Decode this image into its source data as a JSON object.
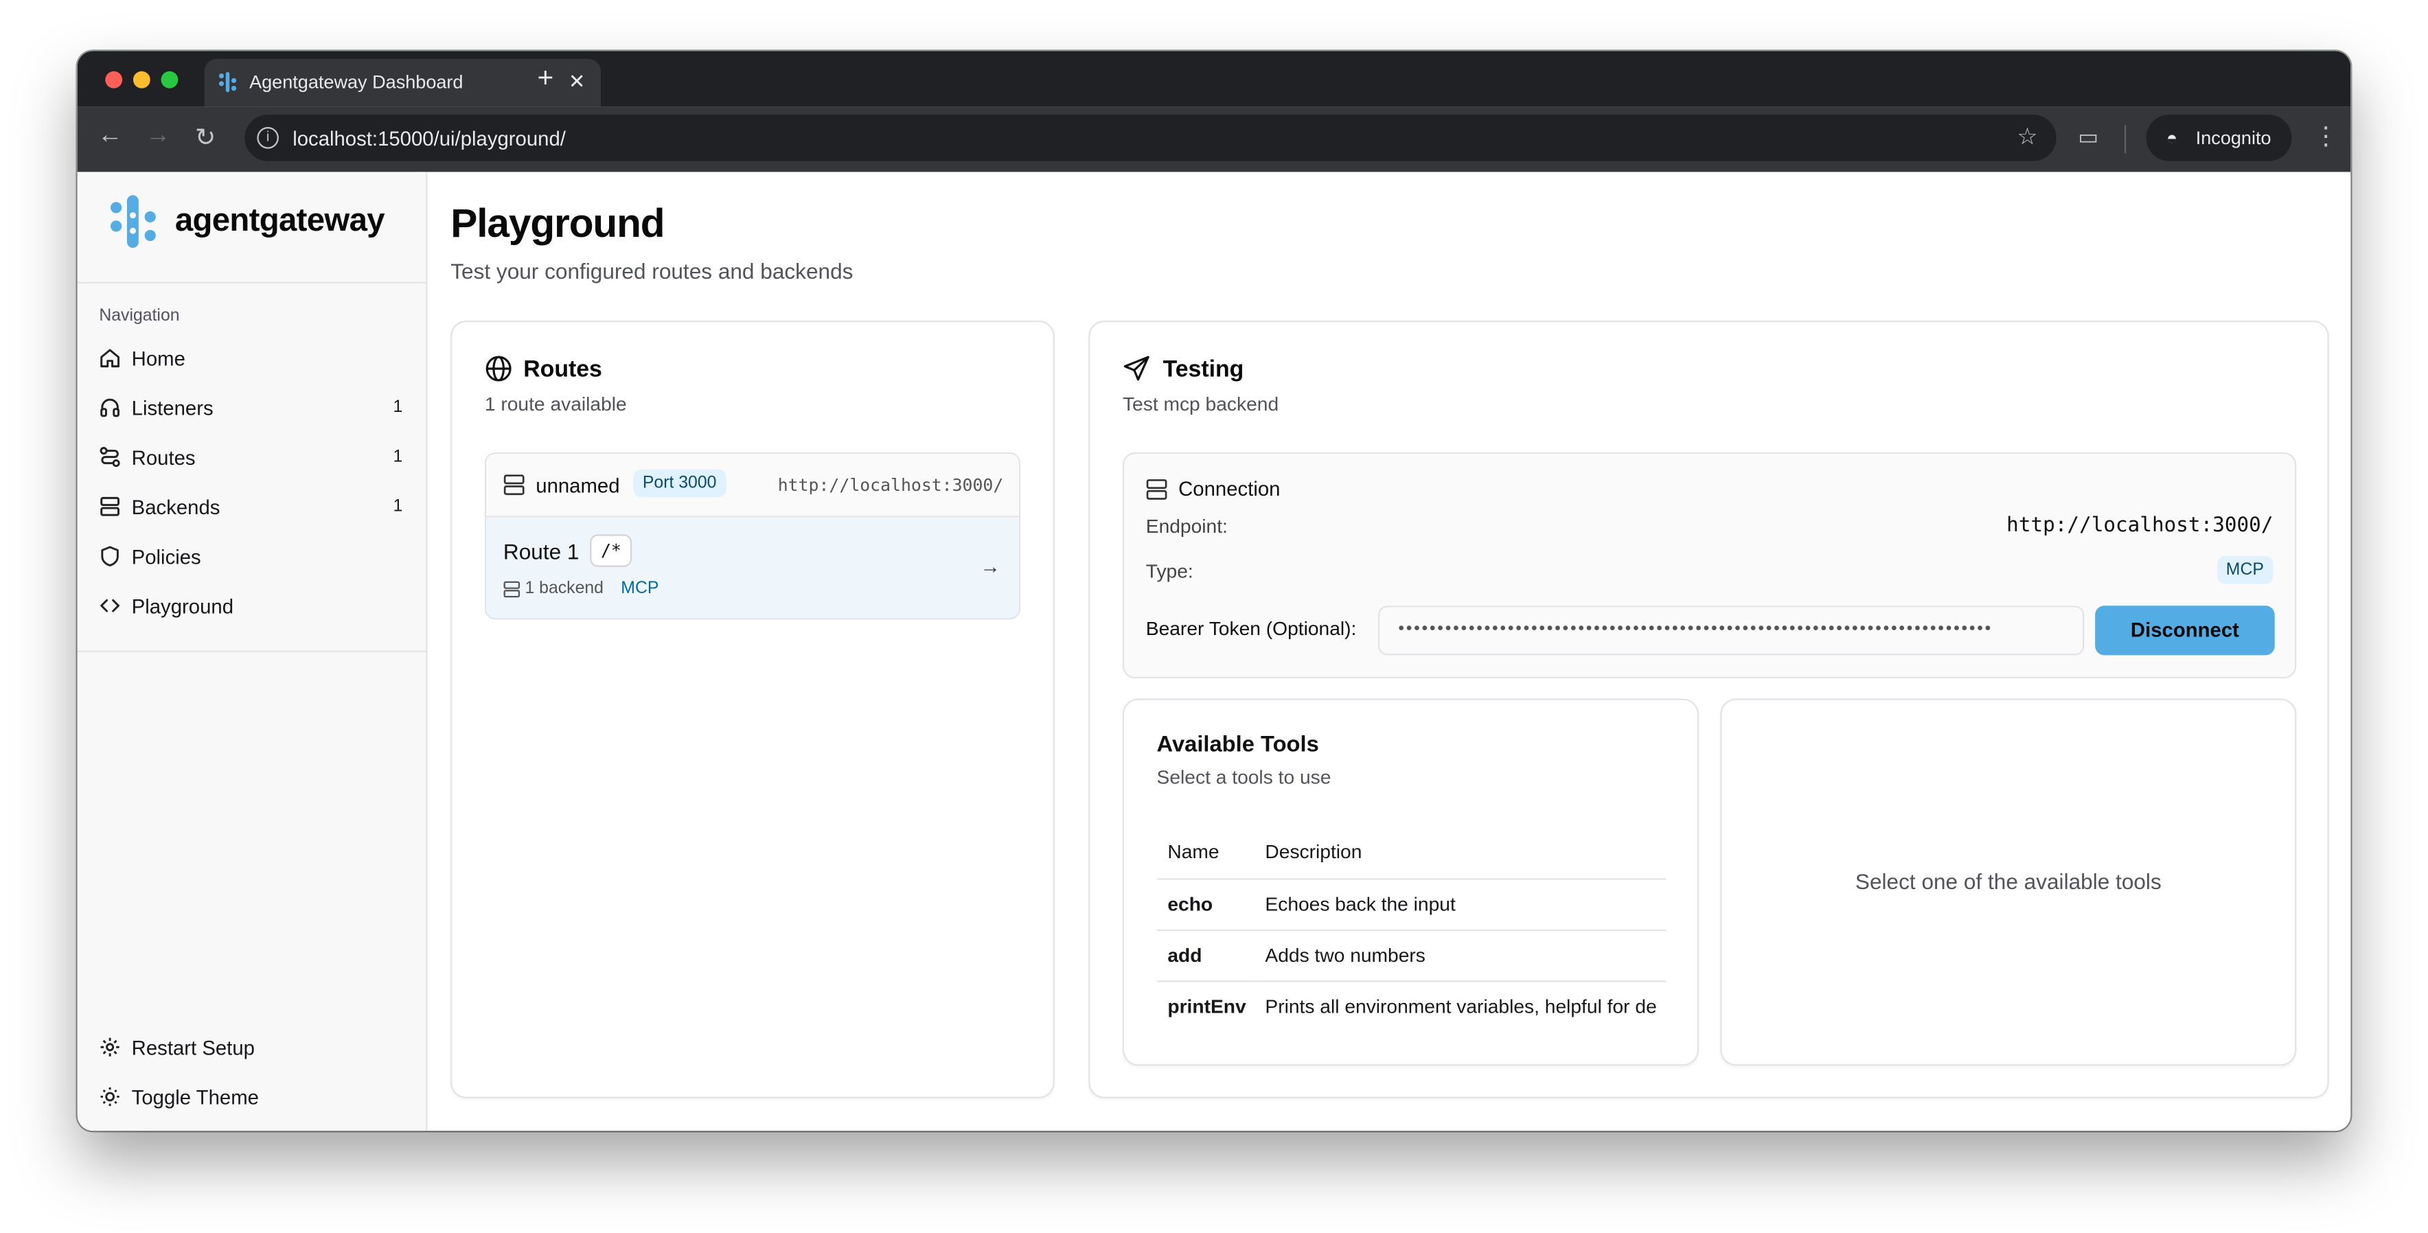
{
  "browser": {
    "tab_title": "Agentgateway Dashboard",
    "url": "localhost:15000/ui/playground/",
    "incognito_label": "Incognito"
  },
  "sidebar": {
    "brand": "agentgateway",
    "nav_heading": "Navigation",
    "items": [
      {
        "label": "Home",
        "count": "",
        "icon": "home-icon"
      },
      {
        "label": "Listeners",
        "count": "1",
        "icon": "headphones-icon"
      },
      {
        "label": "Routes",
        "count": "1",
        "icon": "route-icon"
      },
      {
        "label": "Backends",
        "count": "1",
        "icon": "server-icon"
      },
      {
        "label": "Policies",
        "count": "",
        "icon": "shield-icon"
      },
      {
        "label": "Playground",
        "count": "",
        "icon": "code-icon"
      }
    ],
    "footer": [
      {
        "label": "Restart Setup",
        "icon": "gear-icon"
      },
      {
        "label": "Toggle Theme",
        "icon": "sun-icon"
      }
    ]
  },
  "page": {
    "title": "Playground",
    "subtitle": "Test your configured routes and backends"
  },
  "routes_card": {
    "title": "Routes",
    "description": "1 route available",
    "listener": {
      "name": "unnamed",
      "port_badge": "Port 3000",
      "url": "http://localhost:3000/"
    },
    "route": {
      "name": "Route 1",
      "path": "/*",
      "backend_count": "1 backend",
      "backend_type": "MCP"
    }
  },
  "testing_card": {
    "title": "Testing",
    "description": "Test mcp backend",
    "connection": {
      "title": "Connection",
      "endpoint_label": "Endpoint:",
      "endpoint_value": "http://localhost:3000/",
      "type_label": "Type:",
      "type_value": "MCP",
      "token_label": "Bearer Token (Optional):",
      "token_value": "••••••••••••••••••••••••••••••••••••••••••••••••••••••••••••••••••••••••••••",
      "disconnect_label": "Disconnect"
    },
    "tools": {
      "title": "Available Tools",
      "description": "Select a tools to use",
      "columns": [
        "Name",
        "Description"
      ],
      "rows": [
        {
          "name": "echo",
          "description": "Echoes back the input"
        },
        {
          "name": "add",
          "description": "Adds two numbers"
        },
        {
          "name": "printEnv",
          "description": "Prints all environment variables, helpful for de"
        }
      ]
    },
    "empty_state": "Select one of the available tools"
  },
  "colors": {
    "accent": "#53ade4",
    "badge_bg": "#e0f2fe",
    "badge_text": "#0369a1",
    "route_selected_bg": "#eef6fc"
  }
}
